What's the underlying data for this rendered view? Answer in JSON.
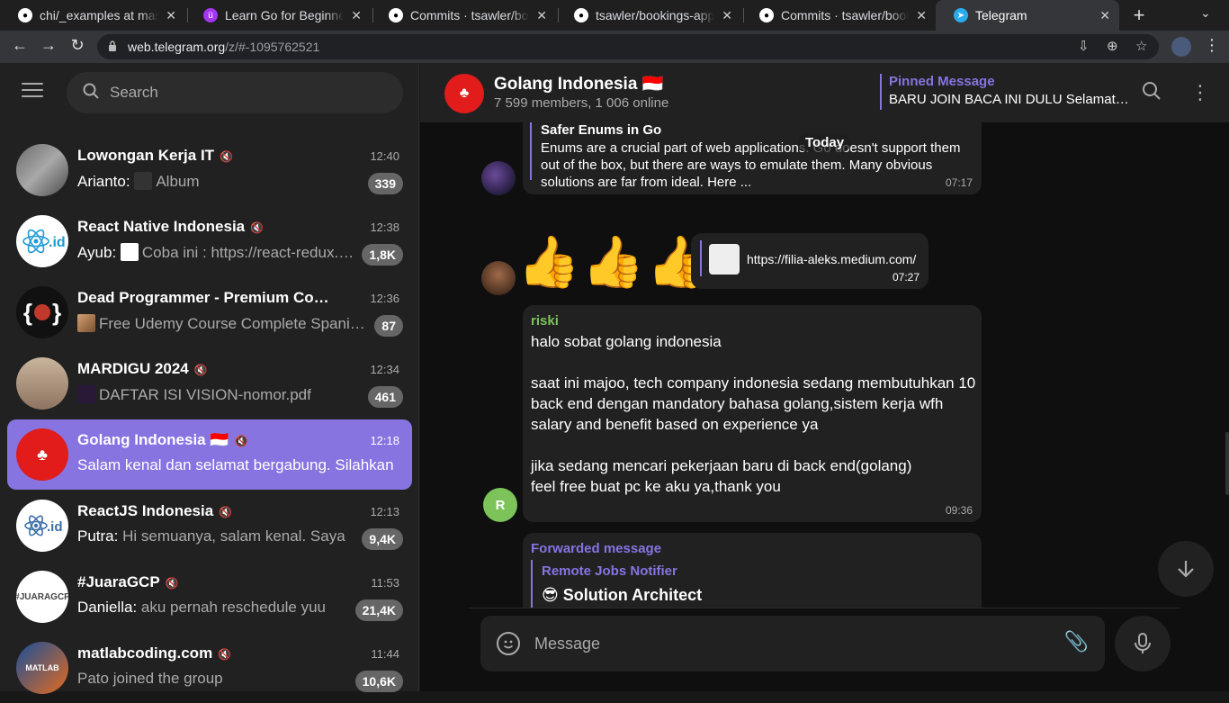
{
  "browser": {
    "tabs": [
      {
        "title": "chi/_examples at master",
        "favicon": "github-icon",
        "color": "#ffffff"
      },
      {
        "title": "Learn Go for Beginners C",
        "favicon": "udemy-icon",
        "color": "#a435f0"
      },
      {
        "title": "Commits · tsawler/book",
        "favicon": "github-icon",
        "color": "#ffffff"
      },
      {
        "title": "tsawler/bookings-app:",
        "favicon": "github-icon",
        "color": "#ffffff"
      },
      {
        "title": "Commits · tsawler/book",
        "favicon": "github-icon",
        "color": "#ffffff"
      },
      {
        "title": "Telegram",
        "favicon": "telegram-icon",
        "color": "#2aabee"
      }
    ],
    "url_domain": "web.telegram.org",
    "url_path": "/z/#-1095762521"
  },
  "sidebar": {
    "search_placeholder": "Search",
    "chats": [
      {
        "name": "Lowongan Kerja IT",
        "time": "12:40",
        "sender": "Arianto",
        "preview": "Album",
        "badge": "339",
        "avatar_color": "#8a8a8a",
        "active": false
      },
      {
        "name": "React Native Indonesia",
        "time": "12:38",
        "sender": "Ayub",
        "preview": "Coba ini : https://react-redux.js.org/",
        "badge": "1,8K",
        "avatar_color": "#ffffff",
        "active": false
      },
      {
        "name": "Dead Programmer - Premium Courses",
        "time": "12:36",
        "sender": "",
        "preview": "Free Udemy Course Complete Spanish",
        "badge": "87",
        "avatar_color": "#1a1a1a",
        "active": false
      },
      {
        "name": "MARDIGU 2024",
        "time": "12:34",
        "sender": "",
        "preview": "DAFTAR ISI VISION-nomor.pdf",
        "badge": "461",
        "avatar_color": "#b8a090",
        "active": false
      },
      {
        "name": "Golang Indonesia 🇮🇩",
        "time": "12:18",
        "sender": "",
        "preview": "Salam kenal dan selamat bergabung. Silahkan",
        "badge": "",
        "avatar_color": "#e21b1b",
        "active": true
      },
      {
        "name": "ReactJS Indonesia",
        "time": "12:13",
        "sender": "Putra",
        "preview": "Hi semuanya, salam kenal. Saya",
        "badge": "9,4K",
        "avatar_color": "#ffffff",
        "active": false
      },
      {
        "name": "#JuaraGCP",
        "time": "11:53",
        "sender": "Daniella",
        "preview": "aku pernah reschedule yuu",
        "badge": "21,4K",
        "avatar_color": "#ffffff",
        "active": false
      },
      {
        "name": "matlabcoding.com",
        "time": "11:44",
        "sender": "",
        "preview": "Pato joined the group",
        "badge": "10,6K",
        "avatar_color": "#1a4f9a",
        "active": false
      }
    ]
  },
  "chat": {
    "title": "Golang Indonesia 🇮🇩",
    "subtitle": "7 599 members, 1 006 online",
    "pinned_label": "Pinned Message",
    "pinned_text": "BARU JOIN BACA INI DULU Selamat datang",
    "date_pill": "Today",
    "msg1": {
      "preview_title": "Safer Enums in Go",
      "preview_text": "Enums are a crucial part of web applications. Go doesn't support them out of the box, but there are ways to emulate them. Many obvious solutions are far from ideal. Here ...",
      "time": "07:17"
    },
    "msg2": {
      "emoji": "👍👍👍",
      "link": "https://filia-aleks.medium.com/",
      "time": "07:27"
    },
    "msg3": {
      "author": "riski",
      "avatar_letter": "R",
      "lines": [
        "halo sobat golang indonesia",
        "",
        "saat ini majoo, tech company indonesia sedang membutuhkan 10 back end dengan mandatory bahasa golang,sistem kerja wfh",
        "salary and benefit based on experience ya",
        "",
        "jika sedang mencari pekerjaan baru di back end(golang)",
        "feel free buat pc ke aku ya,thank you"
      ],
      "time": "09:36"
    },
    "msg4": {
      "forwarded_label": "Forwarded message",
      "source": "Remote Jobs Notifier",
      "title": "😎 Solution Architect"
    },
    "composer_placeholder": "Message"
  }
}
